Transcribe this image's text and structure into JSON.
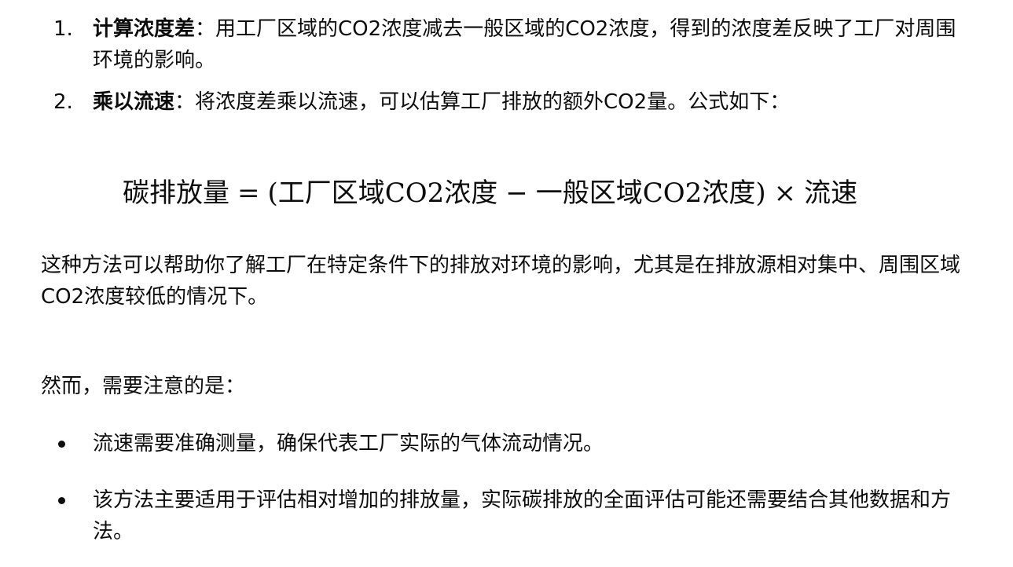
{
  "steps": [
    {
      "number": "1.",
      "term": "计算浓度差",
      "sep": "：",
      "text": "用工厂区域的CO2浓度减去一般区域的CO2浓度，得到的浓度差反映了工厂对周围环境的影响。"
    },
    {
      "number": "2.",
      "term": "乘以流速",
      "sep": "：",
      "text": "将浓度差乘以流速，可以估算工厂排放的额外CO2量。公式如下："
    }
  ],
  "formula": {
    "lhs": "碳排放量",
    "eq": "=",
    "open": "(",
    "factory_term": "工厂区域CO2浓度",
    "minus": "−",
    "general_term": "一般区域CO2浓度",
    "close": ")",
    "times": "×",
    "rate": "流速"
  },
  "paragraphs": {
    "conclusion": "这种方法可以帮助你了解工厂在特定条件下的排放对环境的影响，尤其是在排放源相对集中、周围区域CO2浓度较低的情况下。",
    "caution_intro": "然而，需要注意的是："
  },
  "notes": [
    "流速需要准确测量，确保代表工厂实际的气体流动情况。",
    "该方法主要适用于评估相对增加的排放量，实际碳排放的全面评估可能还需要结合其他数据和方法。"
  ]
}
